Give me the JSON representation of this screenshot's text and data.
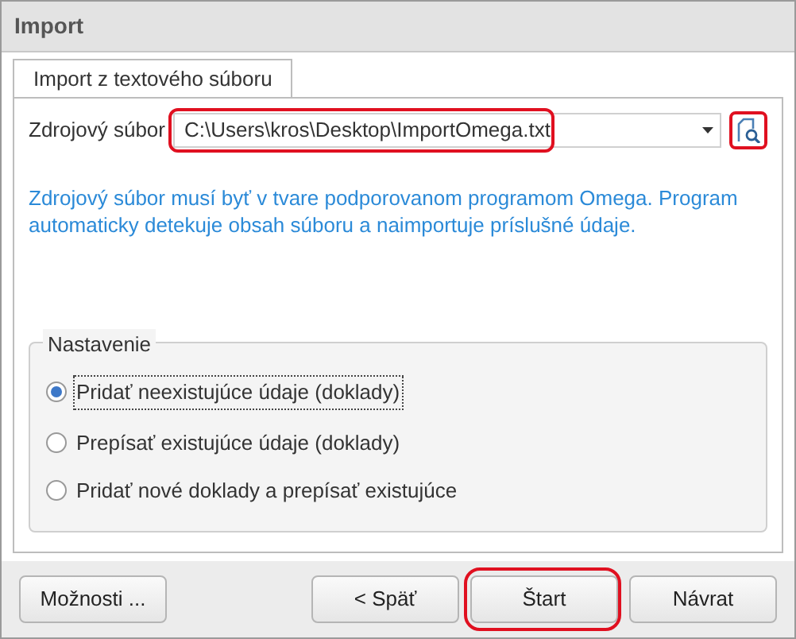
{
  "window": {
    "title": "Import"
  },
  "tabs": [
    {
      "label": "Import z textového súboru",
      "selected": true
    }
  ],
  "source": {
    "label": "Zdrojový súbor",
    "value": "C:\\Users\\kros\\Desktop\\ImportOmega.txt",
    "highlighted": true
  },
  "browse": {
    "highlighted": true
  },
  "description": "Zdrojový súbor musí byť v tvare podporovanom programom Omega. Program automaticky detekuje obsah súboru a naimportuje príslušné údaje.",
  "settings": {
    "title": "Nastavenie",
    "options": [
      {
        "label": "Pridať neexistujúce údaje (doklady)",
        "selected": true
      },
      {
        "label": "Prepísať existujúce údaje (doklady)",
        "selected": false
      },
      {
        "label": "Pridať nové doklady a prepísať existujúce",
        "selected": false
      }
    ]
  },
  "buttons": [
    {
      "label": "Možnosti ...",
      "kind": "left",
      "highlighted": false
    },
    {
      "label": "< Späť",
      "kind": "right",
      "highlighted": false
    },
    {
      "label": "Štart",
      "kind": "right",
      "highlighted": true
    },
    {
      "label": "Návrat",
      "kind": "right",
      "highlighted": false
    }
  ]
}
